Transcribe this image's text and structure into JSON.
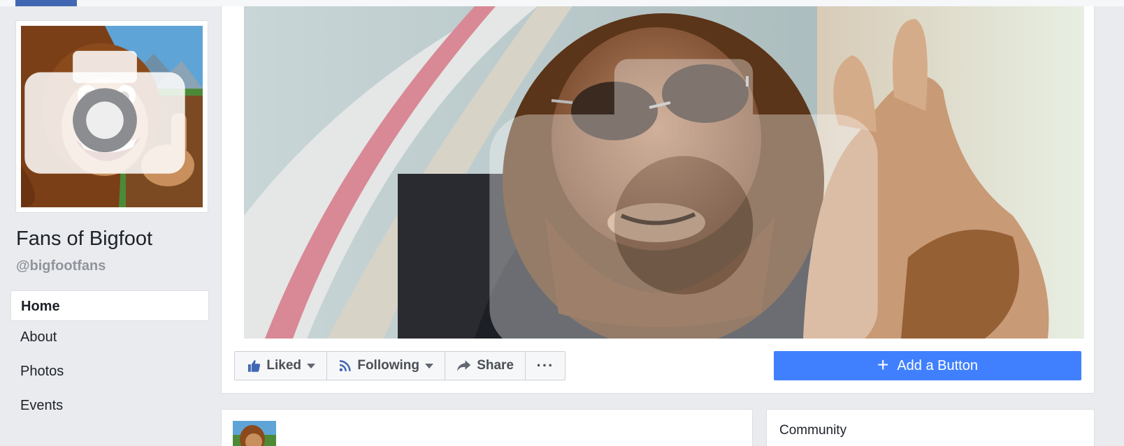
{
  "page": {
    "name": "Fans of Bigfoot",
    "handle": "@bigfootfans"
  },
  "nav": {
    "items": [
      {
        "label": "Home",
        "active": true
      },
      {
        "label": "About",
        "active": false
      },
      {
        "label": "Photos",
        "active": false
      },
      {
        "label": "Events",
        "active": false
      }
    ]
  },
  "actions": {
    "liked_label": "Liked",
    "following_label": "Following",
    "share_label": "Share",
    "more_label": "···",
    "add_button_label": "Add a Button"
  },
  "sidebar_cards": {
    "community_title": "Community"
  },
  "colors": {
    "brand_blue": "#4267b2",
    "add_button": "#4080ff",
    "background": "#e9ebee"
  }
}
